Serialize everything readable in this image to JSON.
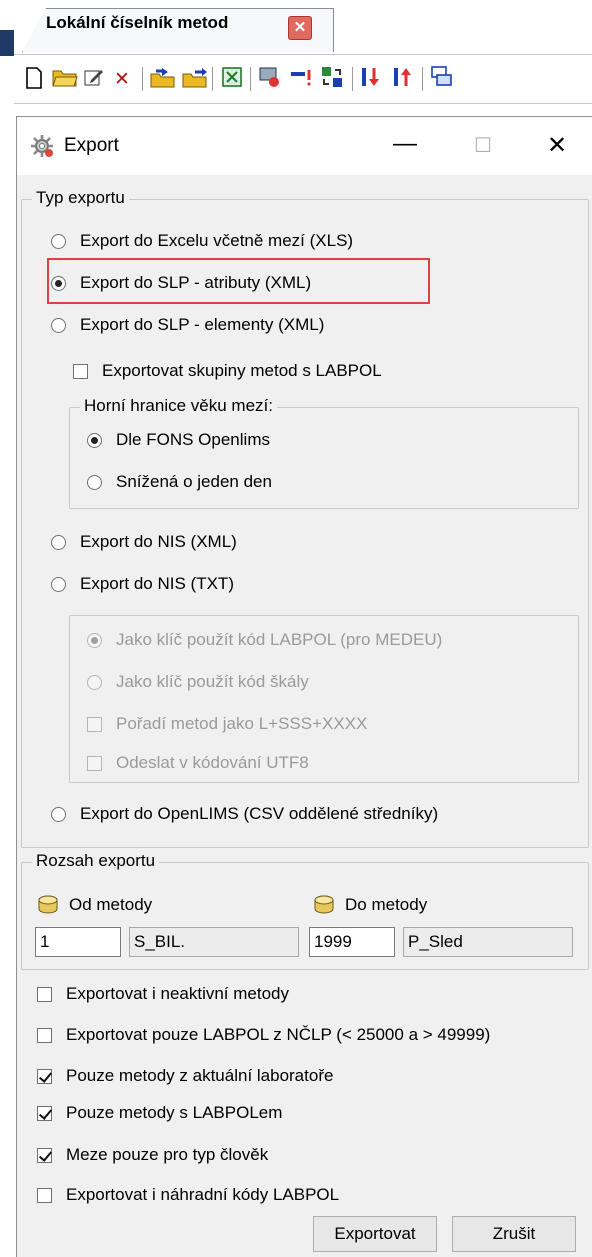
{
  "tab": {
    "label": "Lokální číselník metod",
    "close": "✕"
  },
  "toolbar": {
    "icons": [
      "new-icon",
      "open-folder-icon",
      "edit-icon",
      "delete-icon",
      "import-icon",
      "export-icon",
      "excel-icon",
      "tools-icon",
      "filter-icon",
      "swap-icon",
      "sort-down-icon",
      "sort-up-icon",
      "windows-icon"
    ]
  },
  "dialog": {
    "title": "Export",
    "min": "—",
    "max": "☐",
    "close": "✕",
    "type_group": {
      "legend": "Typ exportu",
      "opt_xls": "Export do Excelu včetně mezí (XLS)",
      "opt_slp_attr": "Export do SLP - atributy (XML)",
      "opt_slp_elem": "Export do SLP - elementy (XML)",
      "chk_groups": "Exportovat skupiny metod s LABPOL",
      "age_group": {
        "legend": "Horní hranice věku mezí:",
        "opt_fons": "Dle FONS Openlims",
        "opt_minus": "Snížená o jeden den"
      },
      "opt_nis_xml": "Export do NIS (XML)",
      "opt_nis_txt": "Export do NIS (TXT)",
      "nis_group": {
        "opt_labpol": "Jako klíč použít kód LABPOL (pro MEDEU)",
        "opt_scale": "Jako klíč použít kód škály",
        "chk_order": "Pořadí metod jako L+SSS+XXXX",
        "chk_utf8": "Odeslat v kódování UTF8"
      },
      "opt_openlims": "Export do OpenLIMS (CSV oddělené středníky)"
    },
    "range_group": {
      "legend": "Rozsah exportu",
      "from_label": "Od metody",
      "to_label": "Do metody",
      "from_code": "1",
      "from_name": "S_BIL.",
      "to_code": "1999",
      "to_name": "P_Sled"
    },
    "options": {
      "inactive": "Exportovat i neaktivní metody",
      "labpol_only": "Exportovat pouze LABPOL z NČLP (< 25000 a > 49999)",
      "current_lab": "Pouze metody z aktuální laboratoře",
      "with_labpol": "Pouze metody s LABPOLem",
      "human_only": "Meze pouze pro typ člověk",
      "alt_codes": "Exportovat i náhradní kódy LABPOL"
    },
    "buttons": {
      "export": "Exportovat",
      "cancel": "Zrušit"
    }
  }
}
